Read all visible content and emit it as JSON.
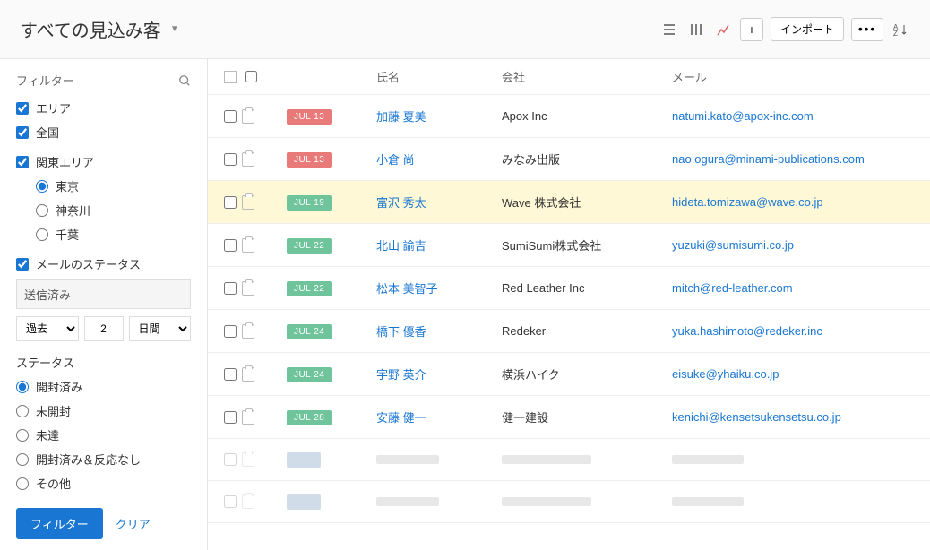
{
  "header": {
    "title": "すべての見込み客",
    "import_label": "インポート"
  },
  "sidebar": {
    "filter_label": "フィルター",
    "area_label": "エリア",
    "nationwide_label": "全国",
    "kanto_label": "関東エリア",
    "regions": {
      "tokyo": "東京",
      "kanagawa": "神奈川",
      "chiba": "千葉"
    },
    "mail_status_label": "メールのステータス",
    "sent_label": "送信済み",
    "past_label": "過去",
    "date_value": "2",
    "days_label": "日間",
    "status_label": "ステータス",
    "statuses": {
      "opened": "開封済み",
      "unopened": "未開封",
      "undelivered": "未達",
      "opened_no_response": "開封済み＆反応なし",
      "other": "その他"
    },
    "filter_btn": "フィルター",
    "clear_btn": "クリア"
  },
  "table": {
    "headers": {
      "name": "氏名",
      "company": "会社",
      "email": "メール"
    },
    "rows": [
      {
        "date": "JUL 13",
        "badge_color": "red",
        "name": "加藤 夏美",
        "company": "Apox Inc",
        "email": "natumi.kato@apox-inc.com",
        "highlighted": false
      },
      {
        "date": "JUL 13",
        "badge_color": "red",
        "name": "小倉 尚",
        "company": "みなみ出版",
        "email": "nao.ogura@minami-publications.com",
        "highlighted": false
      },
      {
        "date": "JUL 19",
        "badge_color": "green",
        "name": "富沢 秀太",
        "company": "Wave 株式会社",
        "email": "hideta.tomizawa@wave.co.jp",
        "highlighted": true
      },
      {
        "date": "JUL 22",
        "badge_color": "green",
        "name": "北山 諭吉",
        "company": "SumiSumi株式会社",
        "email": "yuzuki@sumisumi.co.jp",
        "highlighted": false
      },
      {
        "date": "JUL 22",
        "badge_color": "green",
        "name": "松本 美智子",
        "company": "Red Leather Inc",
        "email": "mitch@red-leather.com",
        "highlighted": false
      },
      {
        "date": "JUL 24",
        "badge_color": "green",
        "name": "橋下 優香",
        "company": "Redeker",
        "email": "yuka.hashimoto@redeker.inc",
        "highlighted": false
      },
      {
        "date": "JUL 24",
        "badge_color": "green",
        "name": "宇野 英介",
        "company": "横浜ハイク",
        "email": "eisuke@yhaiku.co.jp",
        "highlighted": false
      },
      {
        "date": "JUL 28",
        "badge_color": "green",
        "name": "安藤 健一",
        "company": "健一建設",
        "email": "kenichi@kensetsukensetsu.co.jp",
        "highlighted": false
      }
    ]
  }
}
